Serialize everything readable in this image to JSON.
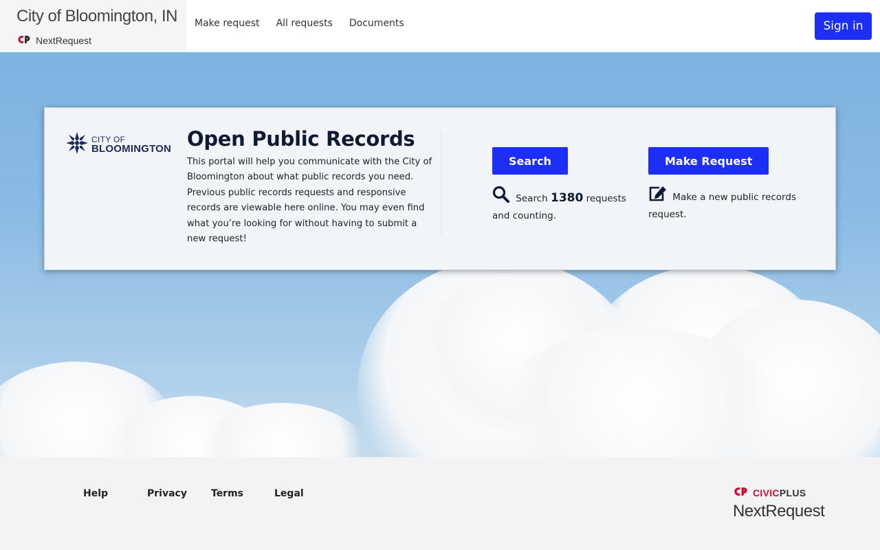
{
  "header": {
    "title": "City of Bloomington, IN",
    "product": "NextRequest",
    "nav": [
      "Make request",
      "All requests",
      "Documents"
    ],
    "signin_label": "Sign in"
  },
  "card": {
    "logo_line1": "CITY OF",
    "logo_line2": "BLOOMINGTON",
    "heading": "Open Public Records",
    "intro": "This portal will help you communicate with the City of Bloomington about what public records you need. Previous public records requests and responsive records are viewable here online. You may even find what you’re looking for without having to submit a new request!",
    "search": {
      "button": "Search",
      "prefix": "Search",
      "count": "1380",
      "suffix": "requests and counting."
    },
    "make_request": {
      "button": "Make Request",
      "description": "Make a new public records request."
    }
  },
  "footer": {
    "links": [
      "Help",
      "Privacy",
      "Terms",
      "Legal"
    ],
    "brand_civic": "CIVIC",
    "brand_plus": "PLUS",
    "brand_product": "NextRequest"
  },
  "colors": {
    "primary": "#1d2ef5",
    "navy": "#1e2a5a",
    "civic_red": "#c8102e"
  }
}
